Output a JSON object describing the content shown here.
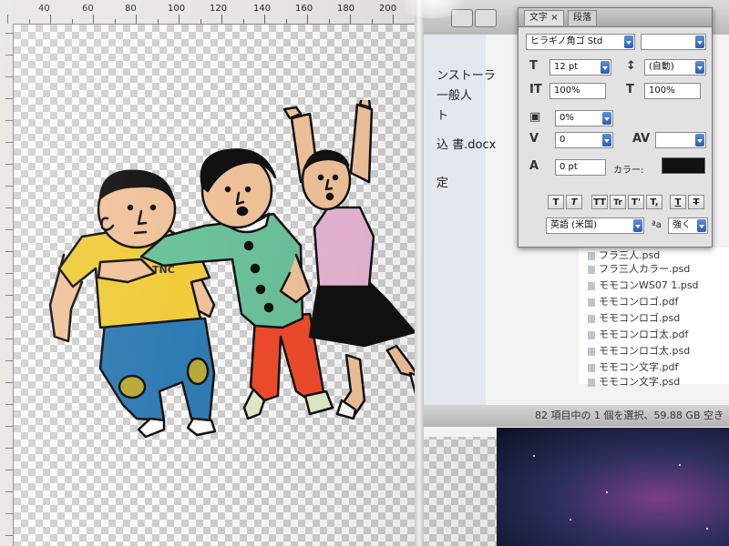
{
  "ruler": {
    "top_ticks": [
      "40",
      "60",
      "80",
      "100",
      "120",
      "140",
      "160",
      "180",
      "200"
    ]
  },
  "character_panel": {
    "tabs": [
      "文字",
      "段落"
    ],
    "tab_close": "×",
    "font_family": "ヒラギノ角ゴ Std",
    "font_style": "",
    "font_size": "12 pt",
    "leading": "(自動)",
    "vertical_scale": "100%",
    "horizontal_scale": "100%",
    "tracking_ratio": "0%",
    "kerning": "0",
    "tracking": "",
    "baseline_shift": "0 pt",
    "color_label": "カラー:",
    "color_value": "#111111",
    "style_buttons": [
      "T",
      "T",
      "TT",
      "Tr",
      "T'",
      "T,",
      "T",
      "T"
    ],
    "language": "英語 (米国)",
    "aa_label": "a",
    "antialias": "強く"
  },
  "finder": {
    "sidebar_items": [
      "ンストーラ",
      "一般人",
      "ト",
      "込 書.docx",
      "",
      "定"
    ],
    "files": [
      "フラ三人.psd",
      "フラ三人カラー.psd",
      "モモコンWS07 1.psd",
      "モモコンロゴ.pdf",
      "モモコンロゴ.psd",
      "モモコンロゴ太.pdf",
      "モモコンロゴ太.psd",
      "モモコン文字.pdf",
      "モモコン文字.psd"
    ],
    "status_bar": "82 項目中の 1 個を選択、59.88 GB 空き"
  },
  "illustration": {
    "shirt_text": "TNC",
    "colors": {
      "skin": "#f0c29a",
      "yellow_shirt": "#f0cc3a",
      "blue_jeans": "#2f7bb3",
      "green_top": "#6cc29a",
      "red_pants": "#ee4b2b",
      "pink_top": "#e7b6d3",
      "black_skirt": "#111111"
    }
  }
}
